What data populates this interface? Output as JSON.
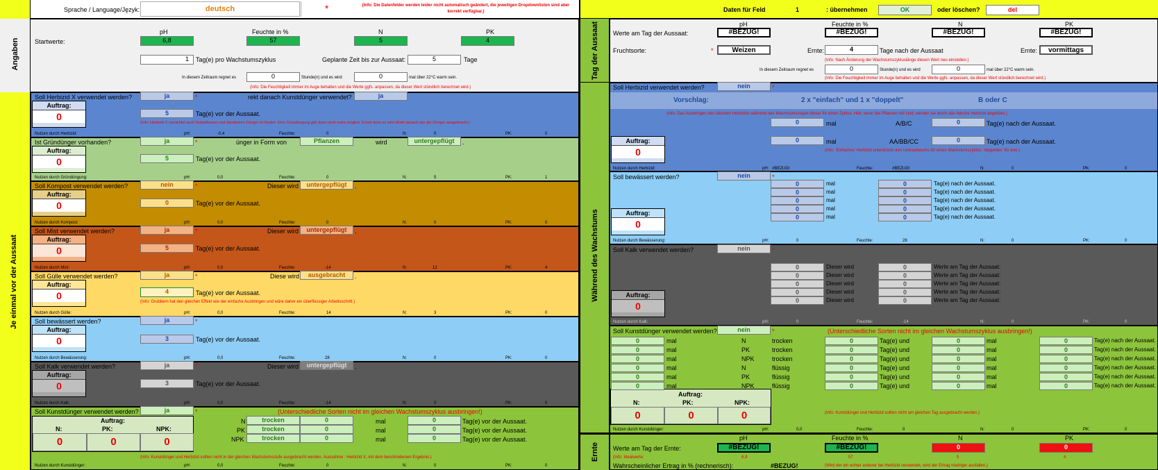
{
  "top": {
    "lang_label": "Sprache / Language/Język:",
    "lang_value": "deutsch",
    "star": "*",
    "info": "(Info: Die Datenfelder werden leider nicht automatisch geändert, die jeweiligen Dropdownlisten sind aber korrekt verfügbar.)",
    "data_label": "Daten für Feld",
    "field_num": "1",
    "uebern": ": übernehmen",
    "ok": "OK",
    "oder": "oder löschen?",
    "del": "del"
  },
  "side": {
    "angaben": "Angaben",
    "jeeinmal": "Je einmal vor der Aussaat",
    "tag": "Tag der Aussaat",
    "waehrend": "Während des Wachstums",
    "ernte": "Ernte"
  },
  "common": {
    "tag_vor": "Tag(e) vor der Aussaat.",
    "tag_nach": "Tag(e) nach der Aussaat.",
    "auftrag": "Auftrag:",
    "zero": "0",
    "ja": "ja",
    "nein": "nein",
    "ph": "pH:",
    "feuchte": "Feuchte:",
    "n": "N:",
    "pk": "PK:",
    "npk": "NPK:",
    "mal": "mal",
    "trocken": "trocken",
    "fluessig": "flüssig",
    "tag_und": "Tag(e) und",
    "dieser_wird": "Dieser wird",
    "werte_tag": "Werte am Tag der Aussaat:",
    "bezug": "#BEZUG!"
  },
  "angaben": {
    "ph_h": "pH",
    "feuchte_h": "Feuchte in %",
    "n_h": "N",
    "pk_h": "PK",
    "startwerte": "Startwerte:",
    "ph_v": "6,8",
    "feuchte_v": "57",
    "n_v": "5",
    "pk_v": "4",
    "zyklus_n": "1",
    "zyklus_l": "Tag(e) pro Wachstumszyklus",
    "geplant_l": "Geplante Zeit bis zur Aussaat:",
    "geplant_v": "5",
    "tage": "Tage",
    "regnet_l": "In diesem Zeitraum regnet es",
    "stunden": "Stunde(n) und es wird",
    "mal_ueber": "mal über 22°C warm sein.",
    "info": "(Info: Die Feuchtigkeit immer im Auge behalten und die Werte ggfs. anpassen, da dieser Wert stündlich berechnet wird.)"
  },
  "herbizid": {
    "q": "Soll Herbizid X verwendet werden?",
    "q2": "rekt danach Kunstdünger verwendet?",
    "tage": "5",
    "info": "(Info: Herbizid X vernichtet auch Nutzpflanzen und dämtlichen Dünger im Boden. Eine Gründüngung gibt dann nicht mehr möglich. Erzeit denn es wird direkt danach wie der Dünger ausgebracht.)",
    "nutzen": "Nutzen durch Herbizid:",
    "ph_v": "-0,4",
    "f_v": "0",
    "n_v": "0",
    "pk_v": "0"
  },
  "gruen": {
    "q": "Ist Gründünger vorhanden?",
    "q2": "ünger in Form von",
    "form": "Pflanzen",
    "wird": "wird",
    "untergepfluegt": "untergepflügt",
    "dot": ".",
    "tage": "5",
    "nutzen": "Nutzen durch Gründüngung:",
    "ph_v": "0,0",
    "f_v": "0",
    "n_v": "5",
    "pk_v": "1"
  },
  "kompost": {
    "q": "Soll Kompost verwendet werden?",
    "tage": "0",
    "nutzen": "Nutzen durch Kompost:",
    "ph_v": "0,0",
    "f_v": "0",
    "n_v": "0",
    "pk_v": "0"
  },
  "mist": {
    "q": "Soll Mist verwendet werden?",
    "tage": "5",
    "nutzen": "Nutzen durch Mist:",
    "ph_v": "0,0",
    "f_v": "-14",
    "n_v": "12",
    "pk_v": "4"
  },
  "guelle": {
    "q": "Soll Gülle verwendet werden?",
    "diese_wird": "Diese wird",
    "ausgebracht": "ausgebracht",
    "tage": "4",
    "info": "(Info: Grubbern hat den gleichen Effekt wie der einfache Ausbringen und wäre daher ein überflüssiger Arbeitsschritt.)",
    "nutzen": "Nutzen durch Gülle:",
    "ph_v": "0,0",
    "f_v": "14",
    "n_v": "3",
    "pk_v": "0"
  },
  "bewaess": {
    "q": "Soll bewässert werden?",
    "tage": "3",
    "nutzen": "Nutzen durch Bewässerung:",
    "ph_v": "0,0",
    "f_v": "28",
    "n_v": "0",
    "pk_v": "0"
  },
  "kalk": {
    "q": "Soll Kalk verwendet werden?",
    "tage": "3",
    "nutzen": "Nutzen durch Kalk:",
    "ph_v": "0,0",
    "f_v": "-14",
    "n_v": "0",
    "pk_v": "0"
  },
  "kunst": {
    "q": "Soll Kunstdünger verwendet werden?",
    "warn": "(Unterschiedliche Sorten nicht im gleichen Wachstumszyklus ausbringen!)",
    "n": "N",
    "pk": "PK",
    "npk": "NPK",
    "info": "(Info: Kunstdünger und Herbizid sollten nicht in der gleichen Wachstumsstufe ausgebracht werden. Ausnahme : Herbizid X, mit dem beschriebenen Ergebnis.)",
    "nutzen": "Nutzen durch Kunstdünger:",
    "ph_v": "0,0",
    "f_v": "0",
    "n_v": "0",
    "pk_v": "0"
  },
  "tda": {
    "ph_h": "pH",
    "feuchte_h": "Feuchte in %",
    "n_h": "N",
    "pk_h": "PK",
    "fruchtsorte": "Fruchtsorte:",
    "frucht": "Weizen",
    "ernte": "Ernte:",
    "ernte_tage": "4",
    "tage_nach": "Tage nach der Aussaat",
    "ernte2": "Ernte:",
    "vormittags": "vormittags",
    "info1": "(Info: Nach Änderung der Wachstumszykluslänge diesen Wert neu einstellen.)",
    "regnet_l": "In diesem Zeitraum regnet es",
    "stunden": "Stunde(n) und es wird",
    "mal_ueber": "mal über 22°C warm sein.",
    "info2": "(Info: Die Feuchtigkeit immer im Auge behalten und die Werte ggfs. anpassen, da dieser Wert stündlich berechnet wird.)"
  },
  "wherb": {
    "q": "Soll Herbizid verwendet werden?",
    "vorschlag": "Vorschlag:",
    "vorschlag_v": "2 x \"einfach\" und 1 x \"doppelt\"",
    "b_oder_c": "B oder C",
    "info": "(Info: Das Ausbringen des falschen Herbizids während des Wachstumsstapel dieser für einen Zyklus. Hier, wenn die Pflanzen reif sind, werden sie durch das falsche Herbizid abgetötet.)",
    "abc": "A/B/C",
    "aabbcc": "AA/BB/CC",
    "info2": "(Info: 'Einfaches' Herbizid unterdrückt den Unkrautwuchs für einen Wachstumszyklus, 'doppeltes' für drei.)",
    "nutzen": "Nutzen durch Herbizid:",
    "n_v": "0",
    "pk_v": "0"
  },
  "wbew": {
    "q": "Soll bewässert werden?",
    "nutzen": "Nutzen durch Bewässerung:",
    "ph_v": "0",
    "f_v": "28",
    "n_v": "0",
    "pk_v": "0"
  },
  "wkalk": {
    "q": "Soll Kalk verwendet werden?",
    "nutzen": "Nutzen durch Kalk:",
    "ph_v": "0",
    "f_v": "-14",
    "n_v": "0",
    "pk_v": "0"
  },
  "wkunst": {
    "q": "Soll Kunstdünger verwendet werden?",
    "warn": "(Unterschiedliche Sorten nicht im gleichen Wachstumszyklus ausbringen!)",
    "info": "(Info: Kunstdünger und Herbizid sollten nicht am gleichen Tag ausgebracht werden.)",
    "nutzen": "Nutzen durch Kunstdünger:",
    "ph_v": "0,0",
    "f_v": "0",
    "n_v": "0",
    "pk_v": "0"
  },
  "ernte": {
    "werte": "Werte am Tag der Ernte:",
    "n_v": "0",
    "pk_v": "0",
    "ideal": "(Info: Idealwerte:",
    "ideal_ph": "6,9",
    "ideal_f": "57",
    "ideal_n": "5",
    "ideal_pk": "4",
    "ertrag": "Wahrscheinlicher Ertrag in % (rechnerisch):",
    "info": "(Wird der ein echter anderer bei Herbizid verwendet, wird der Ertrag niedriger ausfallen.)"
  },
  "colors": {
    "yellow": "#f2ff1a",
    "blue": "#5b86cf",
    "lgreen": "#a6d08a",
    "orange": "#c48c00",
    "rust": "#c4561a",
    "lyellow": "#ffd966",
    "lblue": "#8ecdf5",
    "dgray": "#595959",
    "green": "#8cc43c"
  }
}
